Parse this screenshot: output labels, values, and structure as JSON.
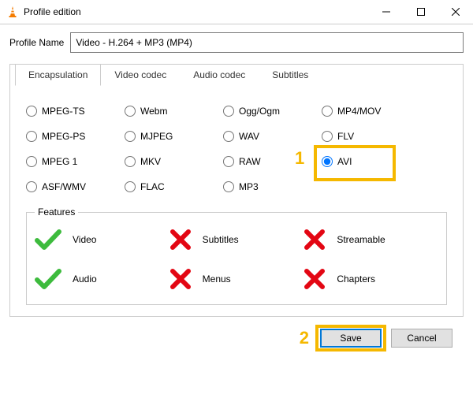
{
  "window": {
    "title": "Profile edition"
  },
  "profileName": {
    "label": "Profile Name",
    "value": "Video - H.264 + MP3 (MP4)"
  },
  "tabs": {
    "encapsulation": "Encapsulation",
    "video_codec": "Video codec",
    "audio_codec": "Audio codec",
    "subtitles": "Subtitles"
  },
  "encapsulation_options": {
    "mpeg_ts": "MPEG-TS",
    "webm": "Webm",
    "ogg": "Ogg/Ogm",
    "mp4": "MP4/MOV",
    "mpeg_ps": "MPEG-PS",
    "mjpeg": "MJPEG",
    "wav": "WAV",
    "flv": "FLV",
    "mpeg1": "MPEG 1",
    "mkv": "MKV",
    "raw": "RAW",
    "avi": "AVI",
    "asf": "ASF/WMV",
    "flac": "FLAC",
    "mp3": "MP3"
  },
  "features": {
    "legend": "Features",
    "video": "Video",
    "subtitles": "Subtitles",
    "streamable": "Streamable",
    "audio": "Audio",
    "menus": "Menus",
    "chapters": "Chapters"
  },
  "buttons": {
    "save": "Save",
    "cancel": "Cancel"
  },
  "annotations": {
    "one": "1",
    "two": "2"
  }
}
